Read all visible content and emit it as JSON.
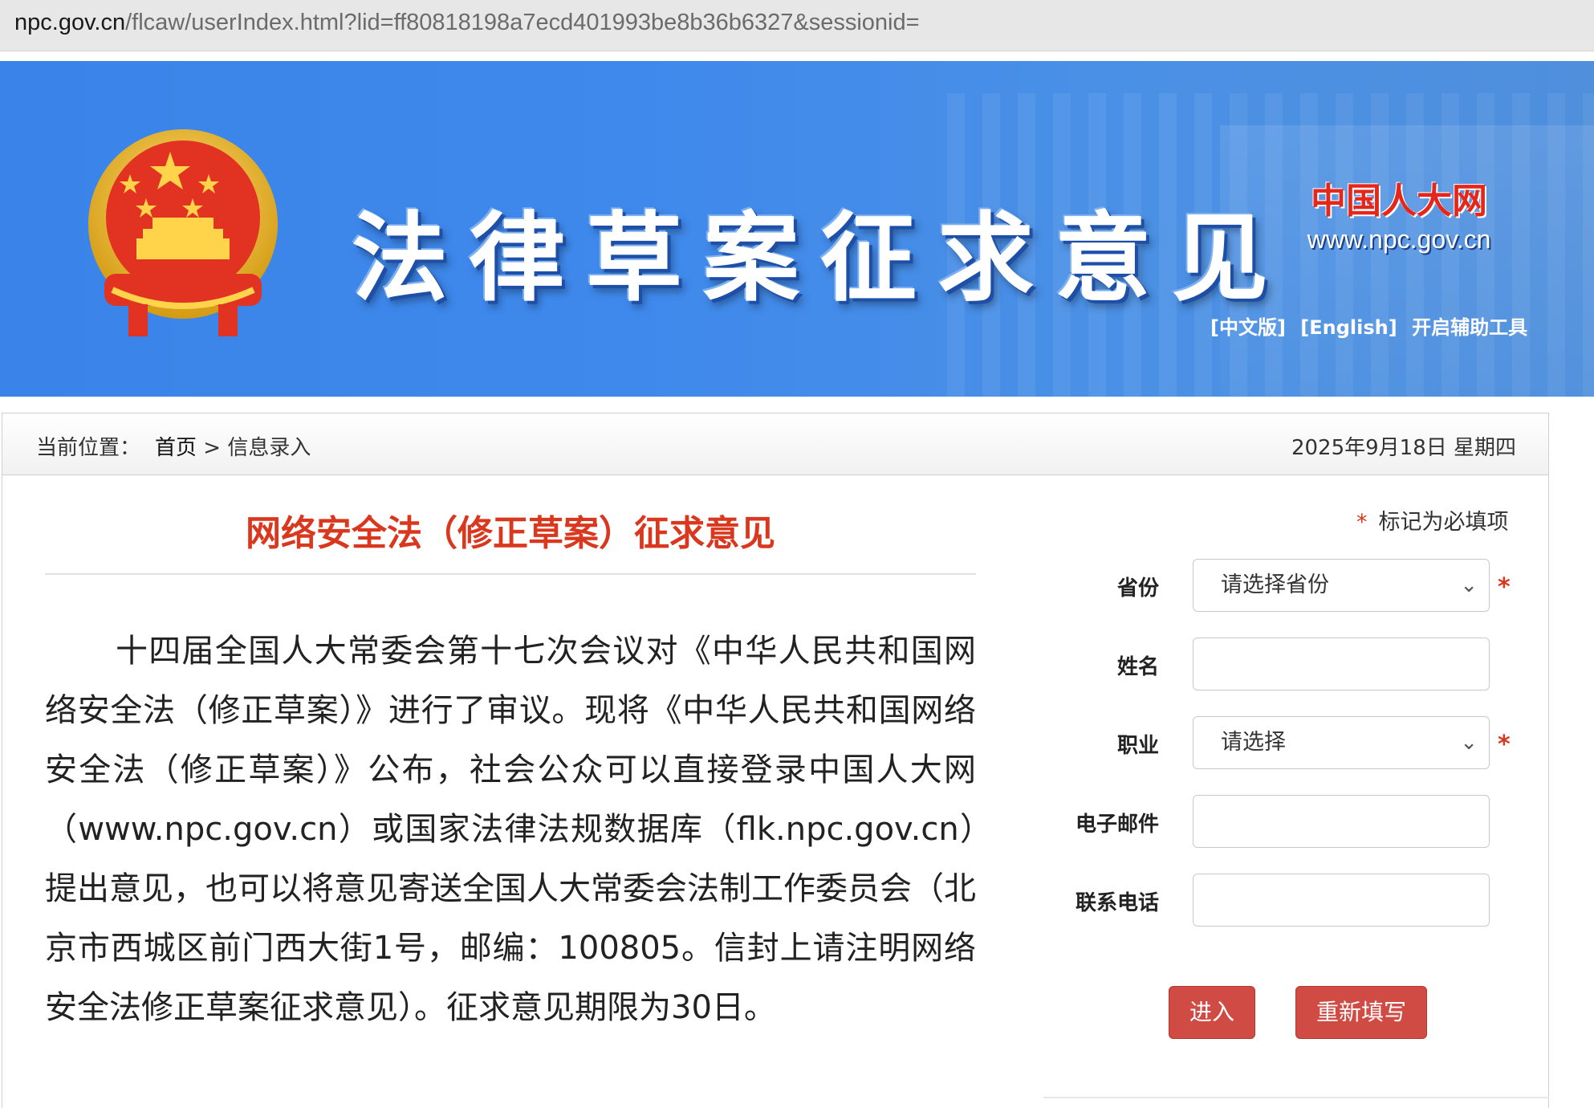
{
  "browser": {
    "url_host": "npc.gov.cn",
    "url_path": "/flcaw/userIndex.html?lid=ff80818198a7ecd401993be8b36b6327&sessionid="
  },
  "banner": {
    "title": "法律草案征求意见",
    "site_name_cn": "中国人大网",
    "site_url": "www.npc.gov.cn",
    "links": [
      "[中文版]",
      "[English]",
      "开启辅助工具"
    ]
  },
  "breadcrumb": {
    "prefix": "当前位置：",
    "home": "首页",
    "separator": ">",
    "current": "信息录入",
    "date": "2025年9月18日 星期四"
  },
  "main": {
    "title": "网络安全法（修正草案）征求意见",
    "notice": "十四届全国人大常委会第十七次会议对《中华人民共和国网络安全法（修正草案）》进行了审议。现将《中华人民共和国网络安全法（修正草案）》公布，社会公众可以直接登录中国人大网（www.npc.gov.cn）或国家法律法规数据库（flk.npc.gov.cn）提出意见，也可以将意见寄送全国人大常委会法制工作委员会（北京市西城区前门西大街1号，邮编：100805。信封上请注明网络安全法修正草案征求意见）。征求意见期限为30日。"
  },
  "form": {
    "required_star": "*",
    "required_hint": "标记为必填项",
    "fields": [
      {
        "label": "省份",
        "type": "select",
        "value": "请选择省份",
        "required": true
      },
      {
        "label": "姓名",
        "type": "text",
        "value": "",
        "required": false
      },
      {
        "label": "职业",
        "type": "select",
        "value": "请选择",
        "required": true
      },
      {
        "label": "电子邮件",
        "type": "text",
        "value": "",
        "required": false
      },
      {
        "label": "联系电话",
        "type": "text",
        "value": "",
        "required": false
      }
    ],
    "submit_label": "进入",
    "reset_label": "重新填写"
  },
  "colors": {
    "banner_blue": "#3f89ec",
    "title_red": "#d9381e",
    "button_red": "#cf4b44"
  }
}
